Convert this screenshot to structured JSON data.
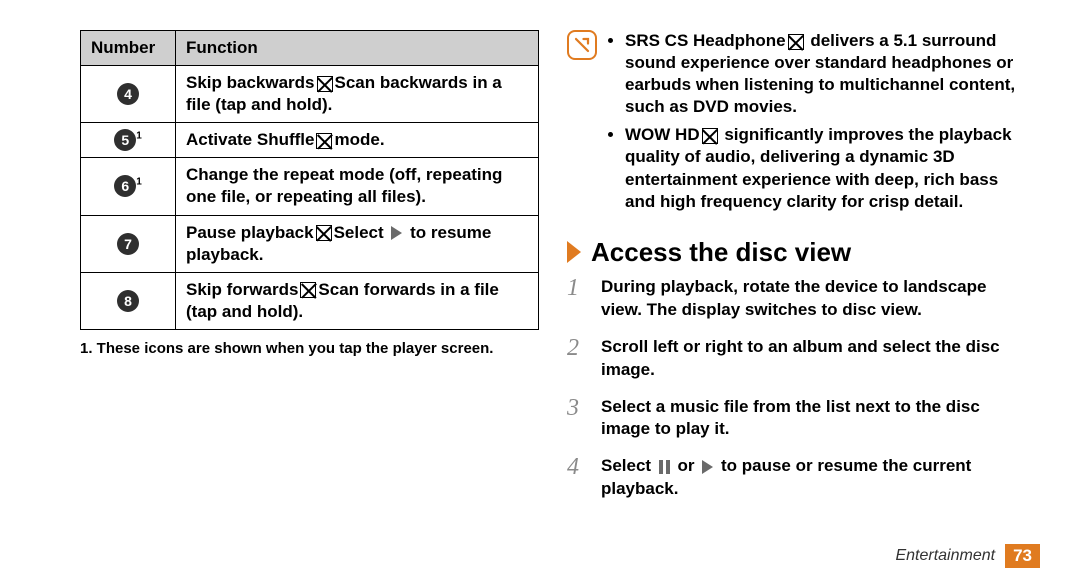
{
  "table": {
    "headers": {
      "number": "Number",
      "function": "Function"
    },
    "rows": [
      {
        "num": "4",
        "sup": "",
        "func_before": "Skip backwards",
        "glyph": "x",
        "func_after": "Scan backwards in a file (tap and hold)."
      },
      {
        "num": "5",
        "sup": "1",
        "func_before": "Activate Shuffle",
        "glyph": "x",
        "func_after": "mode."
      },
      {
        "num": "6",
        "sup": "1",
        "func_before": "Change the repeat mode (off, repeating one file, or repeating all files).",
        "glyph": "",
        "func_after": ""
      },
      {
        "num": "7",
        "sup": "",
        "func_before": "Pause playback",
        "glyph": "x",
        "func_after_before_icon": "Select",
        "icon": "tri-play",
        "func_after": "to resume playback."
      },
      {
        "num": "8",
        "sup": "",
        "func_before": "Skip forwards",
        "glyph": "x",
        "func_after": "Scan forwards in a file (tap and hold)."
      }
    ]
  },
  "footnote": "1. These icons are shown when you tap the player screen.",
  "notes": [
    {
      "before": "SRS CS Headphone",
      "glyph": "x",
      "after": " delivers a 5.1 surround sound experience over standard headphones or earbuds when listening to multichannel content, such as DVD movies."
    },
    {
      "before": "WOW HD",
      "glyph": "x",
      "after": " significantly improves the playback quality of audio, delivering a dynamic 3D entertainment experience with deep, rich bass and high frequency clarity for crisp detail."
    }
  ],
  "heading": "Access the disc view",
  "steps": [
    "During playback, rotate the device to landscape view. The display switches to disc view.",
    "Scroll left or right to an album and select the disc image.",
    "Select a music file from the list next to the disc image to play it.",
    "Select __PAUSE__ or __PLAY__ to pause or resume the current playback."
  ],
  "footer": {
    "section": "Entertainment",
    "page": "73"
  }
}
